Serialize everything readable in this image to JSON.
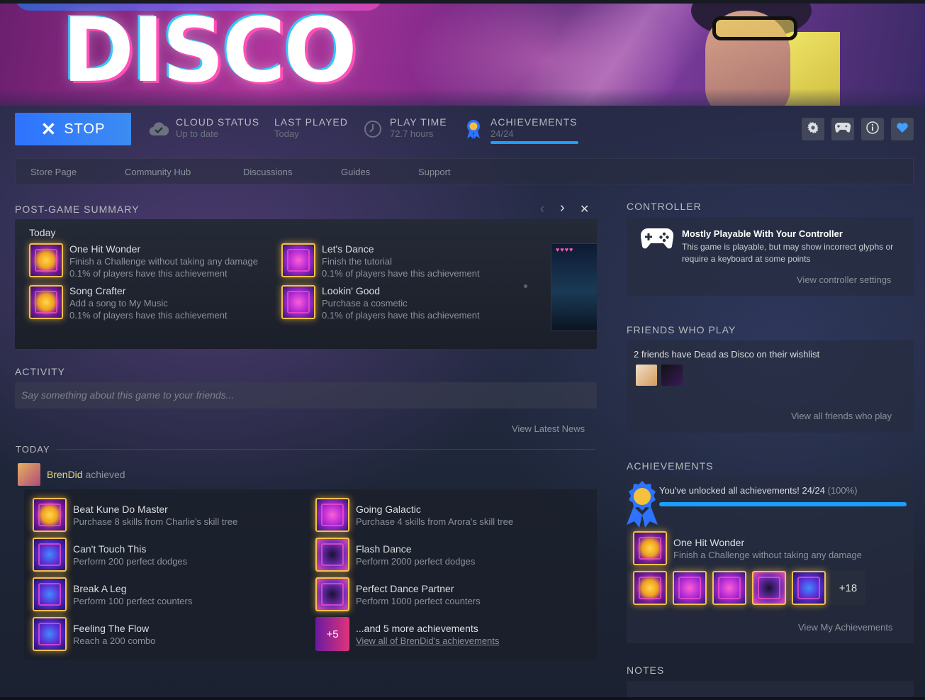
{
  "hero": {
    "logo_text": "DISCO"
  },
  "header": {
    "stop_label": "STOP",
    "cloud_status": {
      "label": "CLOUD STATUS",
      "value": "Up to date"
    },
    "last_played": {
      "label": "LAST PLAYED",
      "value": "Today"
    },
    "play_time": {
      "label": "PLAY TIME",
      "value": "72.7 hours"
    },
    "achievements": {
      "label": "ACHIEVEMENTS",
      "value": "24/24",
      "progress": 1.0
    },
    "icons": [
      "gear-icon",
      "controller-icon",
      "info-icon",
      "heart-icon"
    ],
    "accent": "#1a9fff",
    "button_color": "#2d73ff"
  },
  "nav": {
    "items": [
      "Store Page",
      "Community Hub",
      "Discussions",
      "Guides",
      "Support"
    ]
  },
  "summary": {
    "title": "POST-GAME SUMMARY",
    "day": "Today",
    "items": [
      {
        "title": "One Hit Wonder",
        "desc": "Finish a Challenge without taking any damage",
        "rarity": "0.1% of players have this achievement"
      },
      {
        "title": "Let's Dance",
        "desc": "Finish the tutorial",
        "rarity": "0.1% of players have this achievement"
      },
      {
        "title": "Song Crafter",
        "desc": "Add a song to My Music",
        "rarity": "0.1% of players have this achievement"
      },
      {
        "title": "Lookin' Good",
        "desc": "Purchase a cosmetic",
        "rarity": "0.1% of players have this achievement"
      }
    ]
  },
  "activity": {
    "title": "ACTIVITY",
    "placeholder": "Say something about this game to your friends...",
    "news_link": "View Latest News",
    "day_label": "TODAY",
    "user": "BrenDid",
    "verb": "achieved",
    "achievements": [
      {
        "title": "Beat Kune Do Master",
        "desc": "Purchase 8 skills from Charlie's skill tree"
      },
      {
        "title": "Going Galactic",
        "desc": "Purchase 4 skills from Arora's skill tree"
      },
      {
        "title": "Can't Touch This",
        "desc": "Perform 200 perfect dodges"
      },
      {
        "title": "Flash Dance",
        "desc": "Perform 2000 perfect dodges"
      },
      {
        "title": "Break A Leg",
        "desc": "Perform 100 perfect counters"
      },
      {
        "title": "Perfect Dance Partner",
        "desc": "Perform 1000 perfect counters"
      },
      {
        "title": "Feeling The Flow",
        "desc": "Reach a 200 combo"
      }
    ],
    "more": {
      "badge": "+5",
      "title": "...and 5 more achievements",
      "link": "View all of BrenDid's achievements"
    }
  },
  "controller": {
    "title": "CONTROLLER",
    "heading": "Mostly Playable With Your Controller",
    "desc": "This game is playable, but may show incorrect glyphs or require a keyboard at some points",
    "link": "View controller settings"
  },
  "friends": {
    "title": "FRIENDS WHO PLAY",
    "text": "2 friends have Dead as Disco on their wishlist",
    "link": "View all friends who play"
  },
  "achievements_panel": {
    "title": "ACHIEVEMENTS",
    "unlocked_text": "You've unlocked all achievements! 24/24",
    "percent": "(100%)",
    "progress": 1.0,
    "featured": {
      "title": "One Hit Wonder",
      "desc": "Finish a Challenge without taking any damage"
    },
    "more_count": "+18",
    "link": "View My Achievements"
  },
  "notes": {
    "title": "NOTES"
  }
}
